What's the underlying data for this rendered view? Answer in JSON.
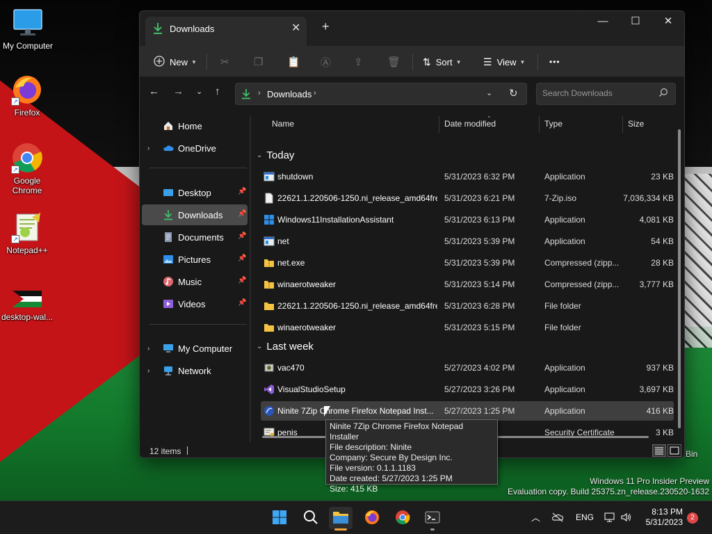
{
  "desktop": {
    "icons": [
      {
        "label": "My Computer"
      },
      {
        "label": "Firefox"
      },
      {
        "label": "Google Chrome"
      },
      {
        "label": "Notepad++"
      },
      {
        "label": "desktop-wal..."
      }
    ],
    "recycle_label": "Bin",
    "watermark_line1": "Windows 11 Pro Insider Preview",
    "watermark_line2": "Evaluation copy. Build 25375.zn_release.230520-1632"
  },
  "window": {
    "tab_title": "Downloads",
    "new_tab": "+",
    "toolbar": {
      "new_label": "New",
      "sort_label": "Sort",
      "view_label": "View",
      "more_label": "•••"
    },
    "address": {
      "path": "Downloads",
      "search_placeholder": "Search Downloads"
    },
    "nav": [
      {
        "label": "Home"
      },
      {
        "label": "OneDrive"
      },
      {
        "label": "Desktop"
      },
      {
        "label": "Downloads"
      },
      {
        "label": "Documents"
      },
      {
        "label": "Pictures"
      },
      {
        "label": "Music"
      },
      {
        "label": "Videos"
      },
      {
        "label": "My Computer"
      },
      {
        "label": "Network"
      }
    ],
    "columns": {
      "name": "Name",
      "date": "Date modified",
      "type": "Type",
      "size": "Size"
    },
    "groups": {
      "today": "Today",
      "last_week": "Last week"
    },
    "files": [
      {
        "name": "shutdown",
        "date": "5/31/2023 6:32 PM",
        "type": "Application",
        "size": "23 KB",
        "icon": "app-icon"
      },
      {
        "name": "22621.1.220506-1250.ni_release_amd64fre...",
        "date": "5/31/2023 6:21 PM",
        "type": "7-Zip.iso",
        "size": "7,036,334 KB",
        "icon": "document-icon"
      },
      {
        "name": "Windows11InstallationAssistant",
        "date": "5/31/2023 6:13 PM",
        "type": "Application",
        "size": "4,081 KB",
        "icon": "windows-logo-icon"
      },
      {
        "name": "net",
        "date": "5/31/2023 5:39 PM",
        "type": "Application",
        "size": "54 KB",
        "icon": "app-icon"
      },
      {
        "name": "net.exe",
        "date": "5/31/2023 5:39 PM",
        "type": "Compressed (zipp...",
        "size": "28 KB",
        "icon": "zip-folder-icon"
      },
      {
        "name": "winaerotweaker",
        "date": "5/31/2023 5:14 PM",
        "type": "Compressed (zipp...",
        "size": "3,777 KB",
        "icon": "zip-folder-icon"
      },
      {
        "name": "22621.1.220506-1250.ni_release_amd64fre...",
        "date": "5/31/2023 6:28 PM",
        "type": "File folder",
        "size": "",
        "icon": "folder-icon"
      },
      {
        "name": "winaerotweaker",
        "date": "5/31/2023 5:15 PM",
        "type": "File folder",
        "size": "",
        "icon": "folder-icon"
      },
      {
        "name": "vac470",
        "date": "5/27/2023 4:02 PM",
        "type": "Application",
        "size": "937 KB",
        "icon": "installer-icon"
      },
      {
        "name": "VisualStudioSetup",
        "date": "5/27/2023 3:26 PM",
        "type": "Application",
        "size": "3,697 KB",
        "icon": "visual-studio-icon"
      },
      {
        "name": "Ninite 7Zip Chrome Firefox Notepad Inst...",
        "date": "5/27/2023 1:25 PM",
        "type": "Application",
        "size": "416 KB",
        "icon": "ninite-icon"
      },
      {
        "name": "penis",
        "date": "",
        "type": "Security Certificate",
        "size": "3 KB",
        "icon": "certificate-icon"
      }
    ],
    "status": {
      "count": "12 items"
    },
    "tooltip": {
      "line1": "Ninite 7Zip Chrome Firefox Notepad Installer",
      "line2": "File description: Ninite",
      "line3": "Company: Secure By Design Inc.",
      "line4": "File version: 0.1.1.1183",
      "line5": "Date created: 5/27/2023 1:25 PM",
      "line6": "Size: 415 KB"
    }
  },
  "taskbar": {
    "lang": "ENG",
    "time": "8:13 PM",
    "date": "5/31/2023",
    "notifications": "2"
  },
  "colors": {
    "accent": "#f4a83c",
    "download_green": "#3fbf6a",
    "folder_yellow": "#f5c342"
  }
}
